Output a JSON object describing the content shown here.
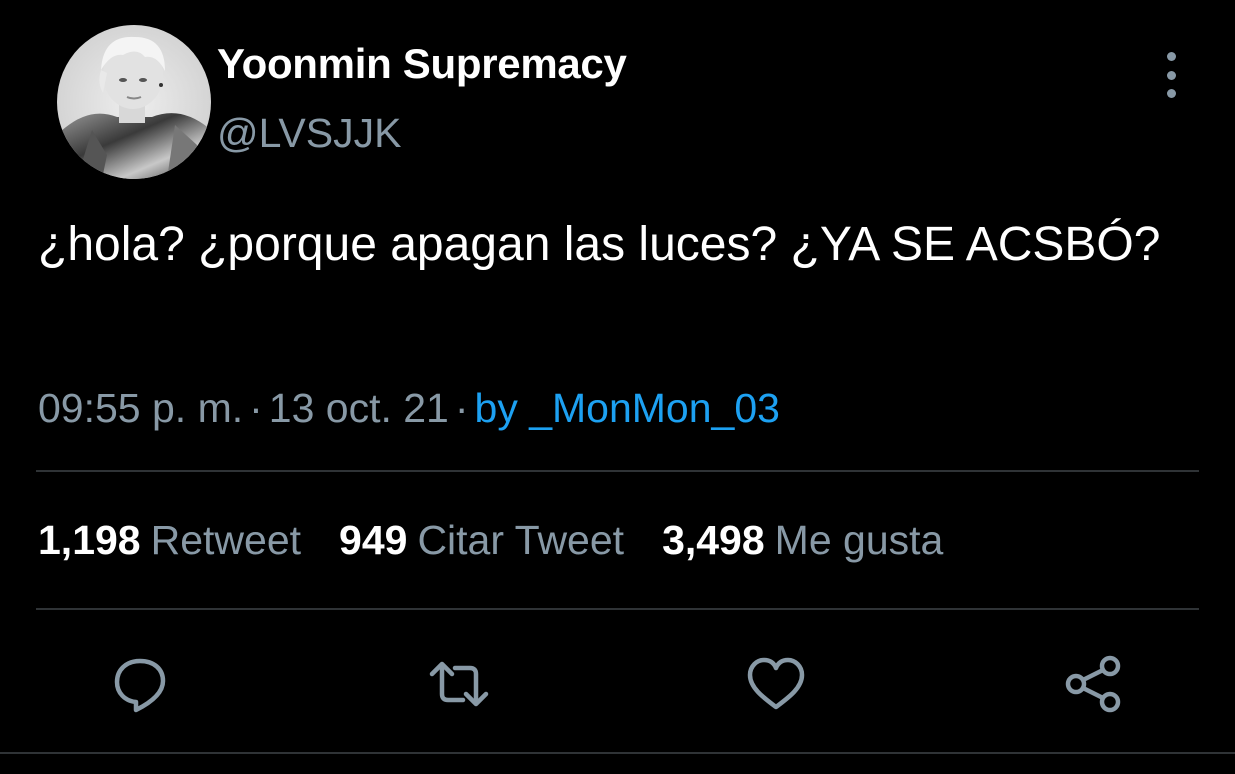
{
  "author": {
    "display_name": "Yoonmin Supremacy",
    "handle": "@LVSJJK",
    "avatar_icon": "profile-photo"
  },
  "tweet": {
    "text": "¿hola? ¿porque apagan las luces? ¿YA SE ACSBÓ?",
    "time": "09:55 p. m.",
    "date": "13 oct. 21",
    "separator": "·",
    "via": "by _MonMon_03"
  },
  "stats": {
    "retweets": {
      "count": "1,198",
      "label": "Retweet"
    },
    "quotes": {
      "count": "949",
      "label": "Citar Tweet"
    },
    "likes": {
      "count": "3,498",
      "label": "Me gusta"
    }
  },
  "actions": [
    "reply-icon",
    "retweet-icon",
    "like-icon",
    "share-icon"
  ],
  "colors": {
    "background": "#000000",
    "text_primary": "#ffffff",
    "text_secondary": "#8899a6",
    "link": "#1da1f2",
    "divider": "#2f3336"
  }
}
